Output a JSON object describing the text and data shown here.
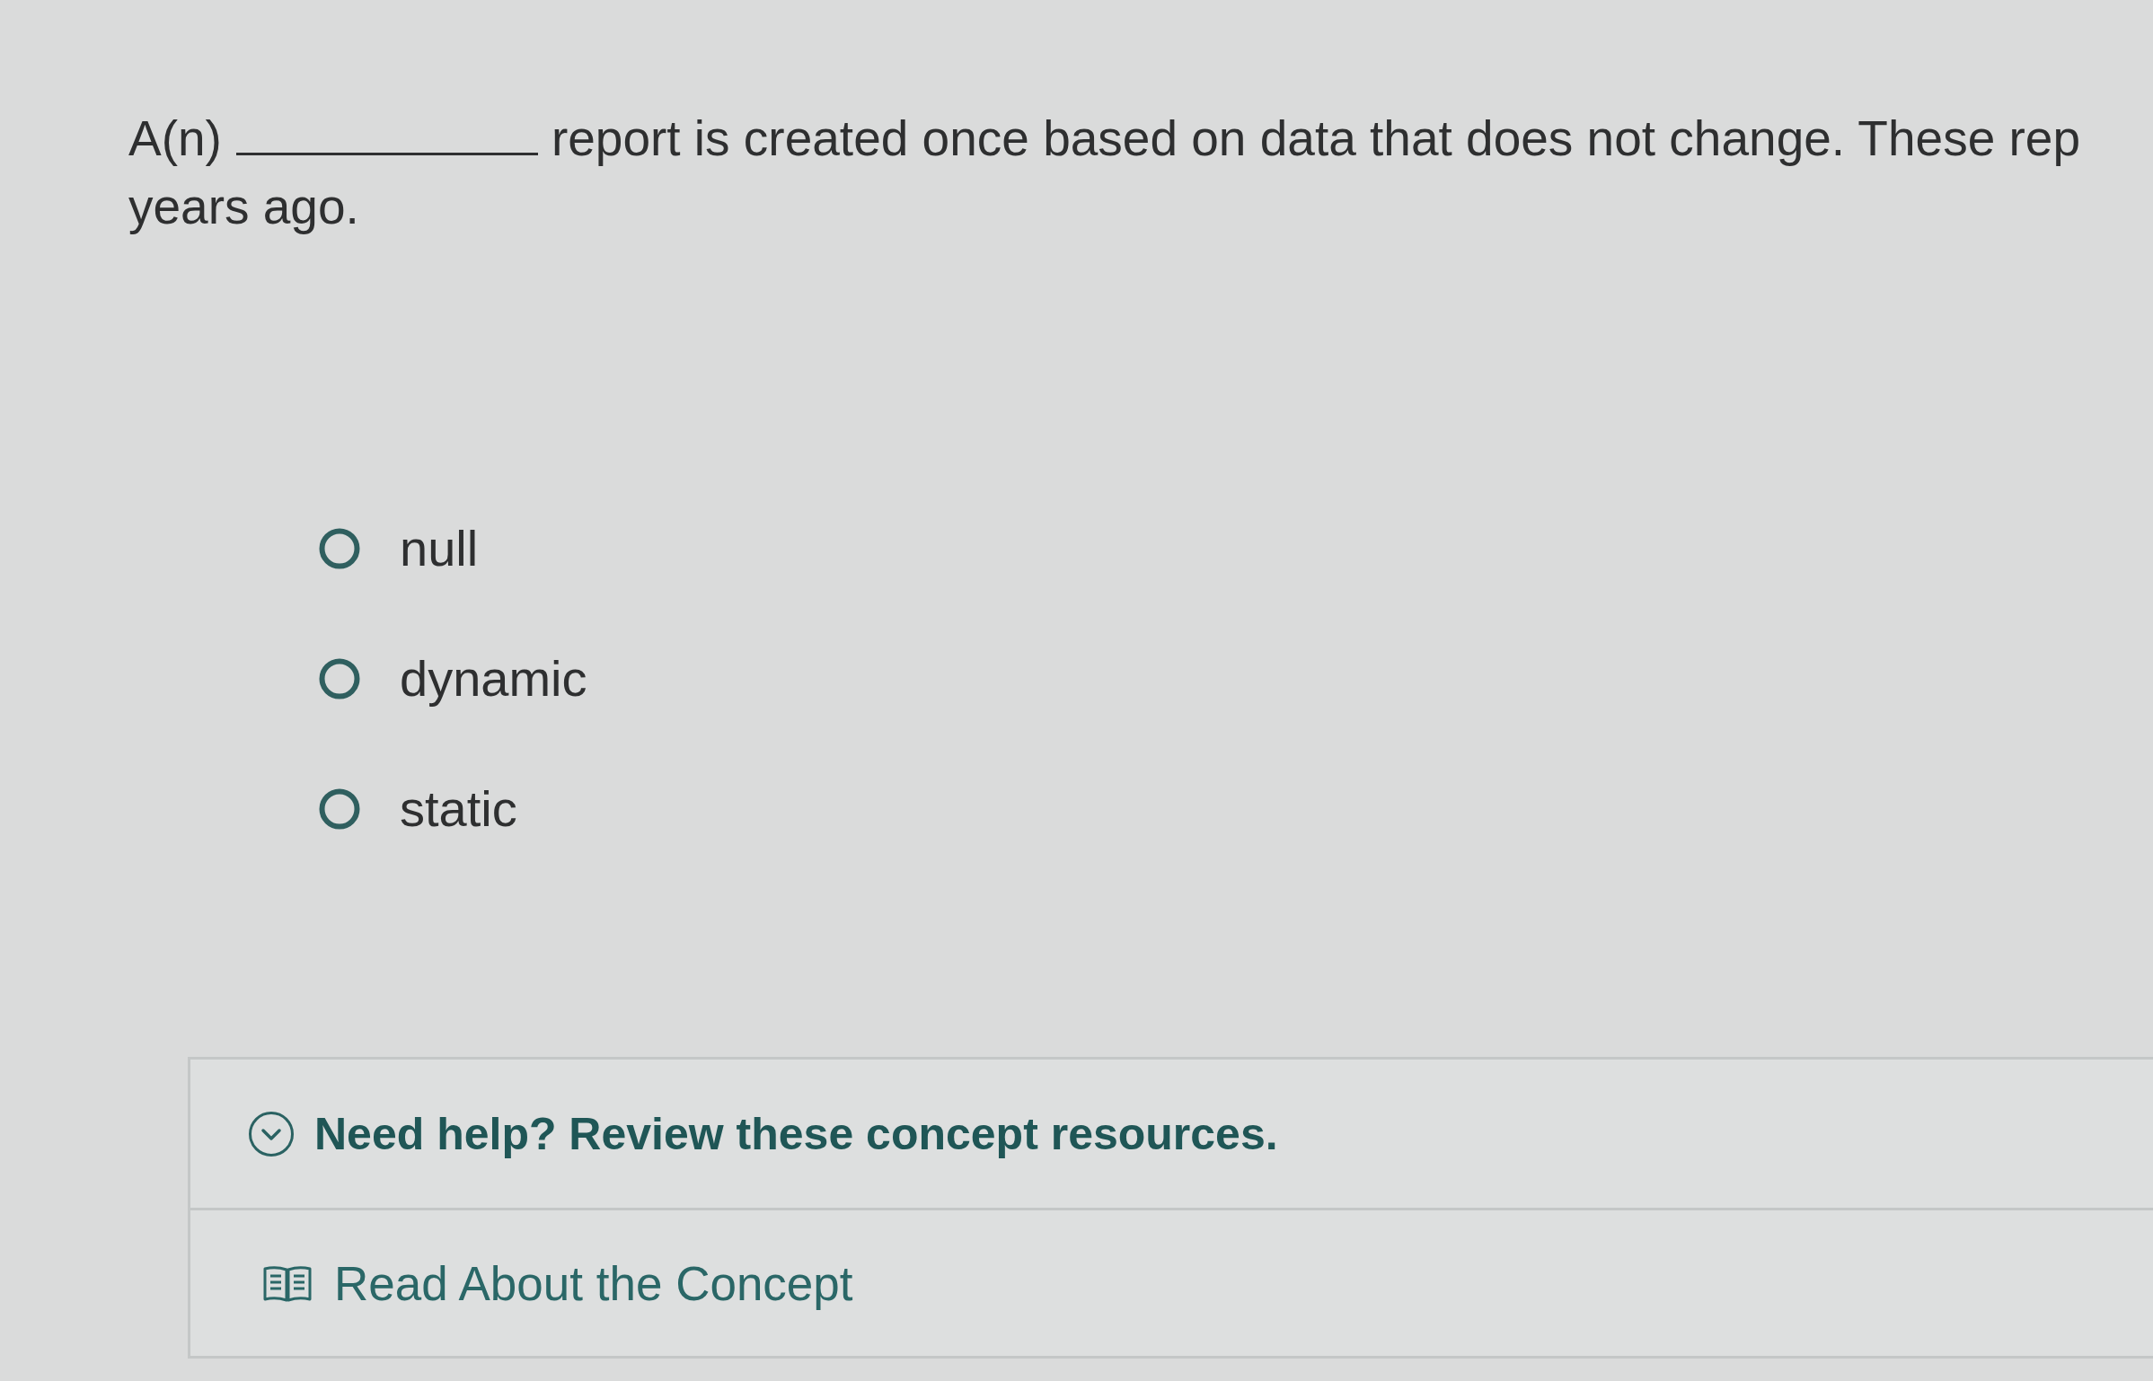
{
  "question": {
    "text_before_blank": "A(n)",
    "text_after_blank": "report is created once based on data that does not change. These rep",
    "text_second_line": "years ago."
  },
  "options": [
    {
      "label": "null",
      "selected": false
    },
    {
      "label": "dynamic",
      "selected": false
    },
    {
      "label": "static",
      "selected": false
    }
  ],
  "help": {
    "title": "Need help? Review these concept resources.",
    "expanded": true,
    "resources": [
      {
        "label": "Read About the Concept"
      }
    ]
  }
}
